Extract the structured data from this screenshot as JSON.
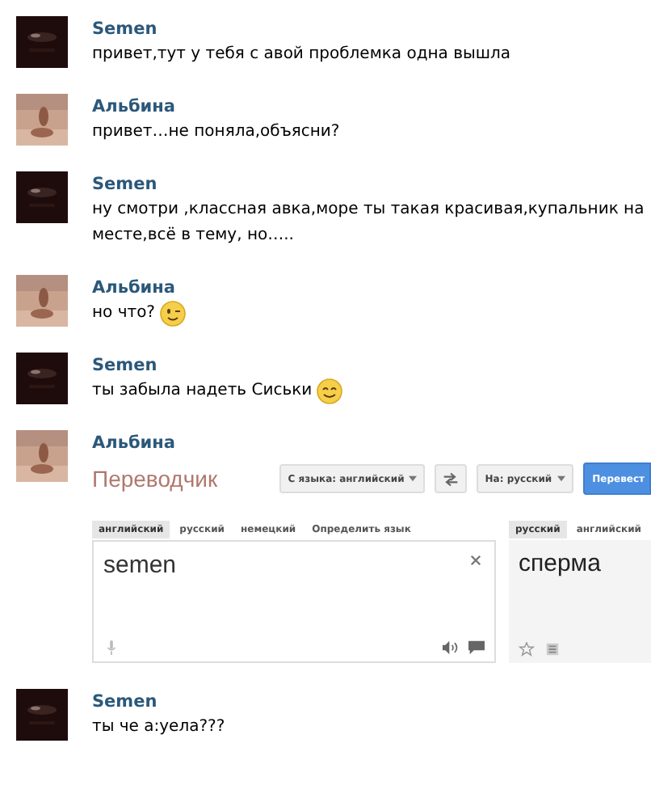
{
  "messages": [
    {
      "author": "Semen",
      "avatar": {
        "kind": "dark"
      },
      "text": "привет,тут у тебя с авой проблемка одна вышла"
    },
    {
      "author": "Альбина",
      "avatar": {
        "kind": "sand"
      },
      "text": "привет…не поняла,объясни?"
    },
    {
      "author": "Semen",
      "avatar": {
        "kind": "dark"
      },
      "text": "ну смотри ,классная авка,море ты такая красивая,купальник на месте,всё в тему, но….."
    },
    {
      "author": "Альбина",
      "avatar": {
        "kind": "sand"
      },
      "text": "но что?",
      "emoji": {
        "kind": "wink"
      }
    },
    {
      "author": "Semen",
      "avatar": {
        "kind": "dark"
      },
      "text": "ты забыла надеть Сиськи",
      "emoji": {
        "kind": "smile"
      }
    },
    {
      "author": "Альбина",
      "avatar": {
        "kind": "sand"
      },
      "translator": {
        "title": "Переводчик",
        "from_button": "С языка: английский",
        "to_button": "На: русский",
        "translate_button": "Перевест",
        "source_tabs": [
          {
            "label": "английский",
            "selected": true
          },
          {
            "label": "русский",
            "selected": false
          },
          {
            "label": "немецкий",
            "selected": false
          },
          {
            "label": "Определить язык",
            "selected": false
          }
        ],
        "source_text": "semen",
        "target_tabs": [
          {
            "label": "русский",
            "selected": true
          },
          {
            "label": "английский",
            "selected": false
          }
        ],
        "result": "сперма"
      }
    },
    {
      "author": "Semen",
      "avatar": {
        "kind": "dark"
      },
      "text": "ты че а:уела???"
    }
  ]
}
